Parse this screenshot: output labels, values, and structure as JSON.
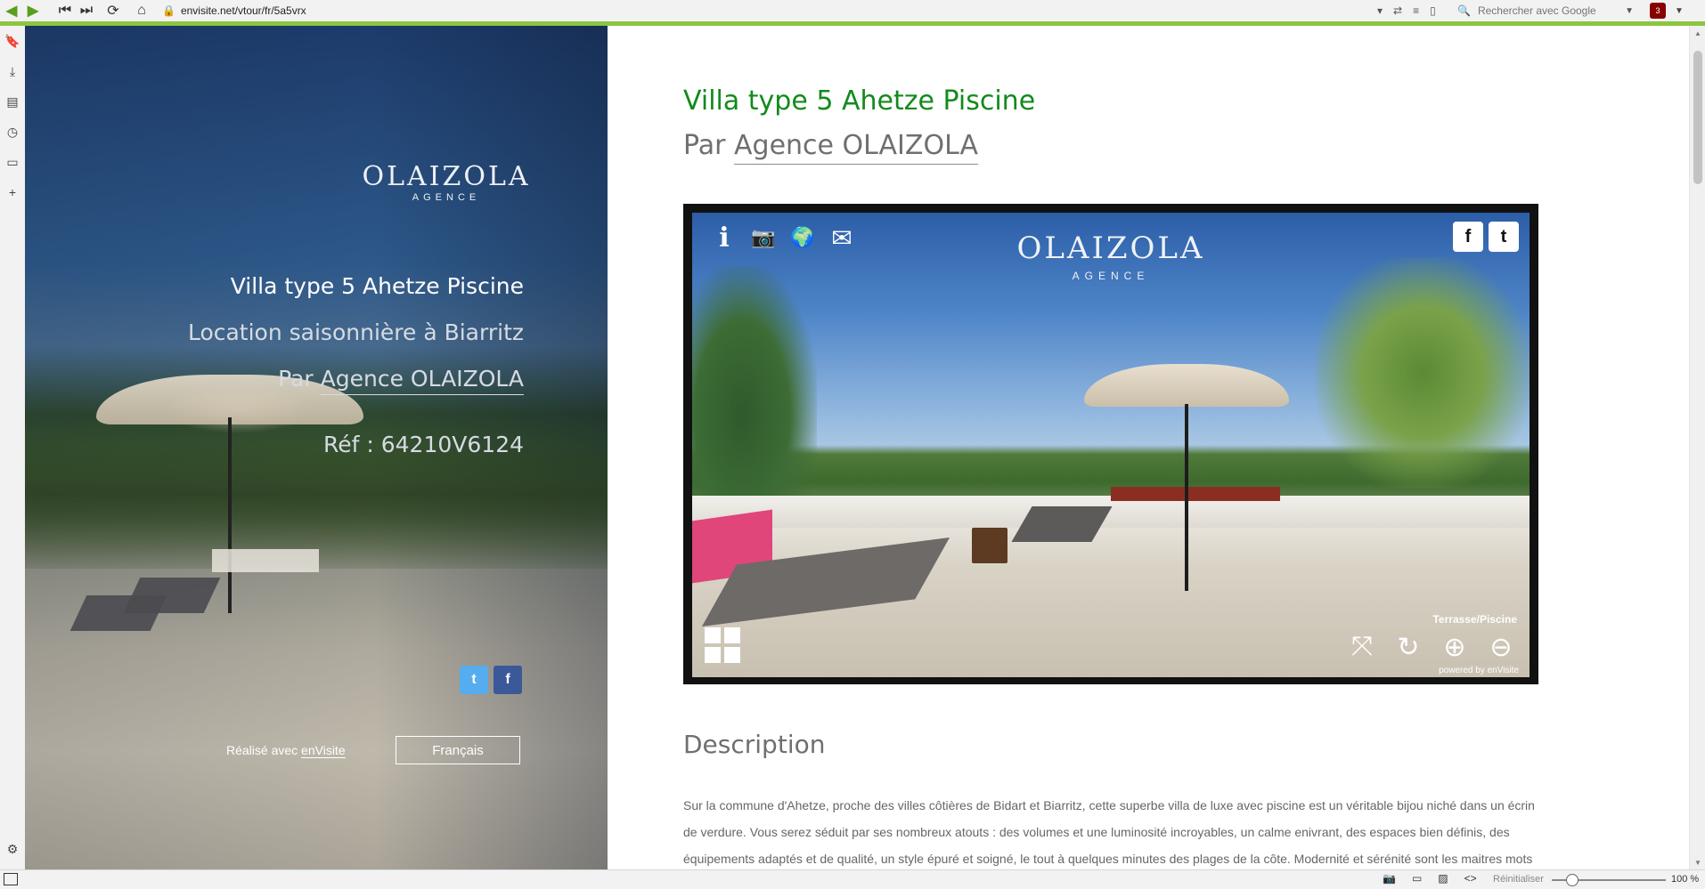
{
  "browser": {
    "url": "envisite.net/vtour/fr/5a5vrx",
    "search_placeholder": "Rechercher avec Google",
    "extension_badge": "3",
    "nav": {
      "back_icon": "◀",
      "forward_icon": "▶",
      "first_icon": "⏮",
      "last_icon": "⏭",
      "reload_icon": "⟳",
      "home_icon": "⌂"
    },
    "accent_color": "#8cc63f"
  },
  "sidebar": {
    "icons": [
      "bookmark-icon",
      "download-icon",
      "notes-icon",
      "history-icon",
      "panel-icon",
      "add-icon"
    ],
    "glyphs": [
      "🔖",
      "⤓",
      "▤",
      "◷",
      "▭",
      "+"
    ],
    "settings_glyph": "⚙"
  },
  "hero": {
    "logo_big": "OLAIZOLA",
    "logo_small": "AGENCE",
    "title": "Villa type 5 Ahetze Piscine",
    "subtitle": "Location saisonnière à Biarritz",
    "by_prefix": "Par ",
    "agency": "Agence OLAIZOLA",
    "ref": "Réf : 64210V6124",
    "made_with_prefix": "Réalisé avec ",
    "made_with_brand": "enVisite",
    "language": "Français",
    "twitter_glyph": "t",
    "facebook_glyph": "f"
  },
  "main": {
    "title": "Villa type 5 Ahetze Piscine",
    "by_prefix": "Par ",
    "agency": "Agence OLAIZOLA",
    "title_color": "#138a1c",
    "description_title": "Description",
    "description_text": "Sur la commune d'Ahetze, proche des villes côtières de Bidart et Biarritz, cette superbe villa de luxe avec piscine est un véritable bijou niché dans un écrin de verdure. Vous serez séduit par ses nombreux atouts : des volumes et une luminosité incroyables, un calme enivrant, des espaces bien définis, des équipements adaptés et de qualité, un style épuré et soigné, le tout à quelques minutes des plages de la côte. Modernité et sérénité sont les maitres mots"
  },
  "viewer": {
    "logo_big": "OLAIZOLA",
    "logo_small": "AGENCE",
    "scene_name": "Terrasse/Piscine",
    "powered_by": "powered by enVisite",
    "tools": {
      "info": "i",
      "camera": "📷",
      "globe": "🌍",
      "mail": "✉"
    },
    "share": {
      "facebook": "f",
      "twitter": "t"
    },
    "controls": {
      "fullscreen": "⤧",
      "rotate": "↻",
      "zoom_in": "⊕",
      "zoom_out": "⊖"
    }
  },
  "status": {
    "reset_label": "Réinitialiser",
    "zoom": "100 %",
    "icons": {
      "screenshot": "📷",
      "window": "▭",
      "image": "▨",
      "code": "<>"
    }
  }
}
